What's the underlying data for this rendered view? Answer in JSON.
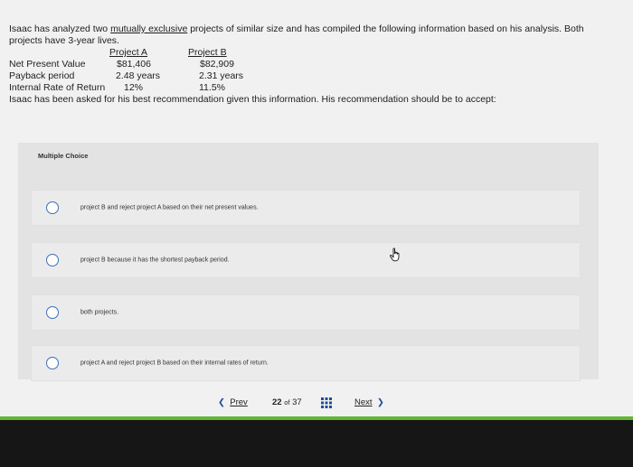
{
  "question": {
    "intro_before": "Isaac has analyzed two ",
    "intro_link": "mutually exclusive",
    "intro_after": " projects of similar size and has compiled the following information based on his analysis. Both projects have 3-year lives.",
    "table": {
      "col_a": "Project A",
      "col_b": "Project B",
      "rows": [
        {
          "label": "Net Present Value",
          "a": "$81,406",
          "b": "$82,909"
        },
        {
          "label": "Payback period",
          "a": "2.48 years",
          "b": "2.31 years"
        },
        {
          "label": "Internal Rate of Return",
          "a": "12%",
          "b": "11.5%"
        }
      ]
    },
    "prompt": "Isaac has been asked for his best recommendation given this information. His recommendation should be to accept:"
  },
  "multiple_choice": {
    "label": "Multiple Choice",
    "choices": [
      "project B and reject project A based on their net present values.",
      "project B because it has the shortest payback period.",
      "both projects.",
      "project A and reject project B based on their internal rates of return."
    ]
  },
  "nav": {
    "prev_label": "Prev",
    "current_page": "22",
    "of_label": "of",
    "total_pages": "37",
    "next_label": "Next"
  },
  "colors": {
    "accent_blue": "#1f4b99",
    "radio_border": "#3f6fb6",
    "progress_green": "#62b832"
  },
  "icons": [
    "chevron-left-icon",
    "chevron-right-icon",
    "grid-icon",
    "hand-pointer-icon"
  ]
}
